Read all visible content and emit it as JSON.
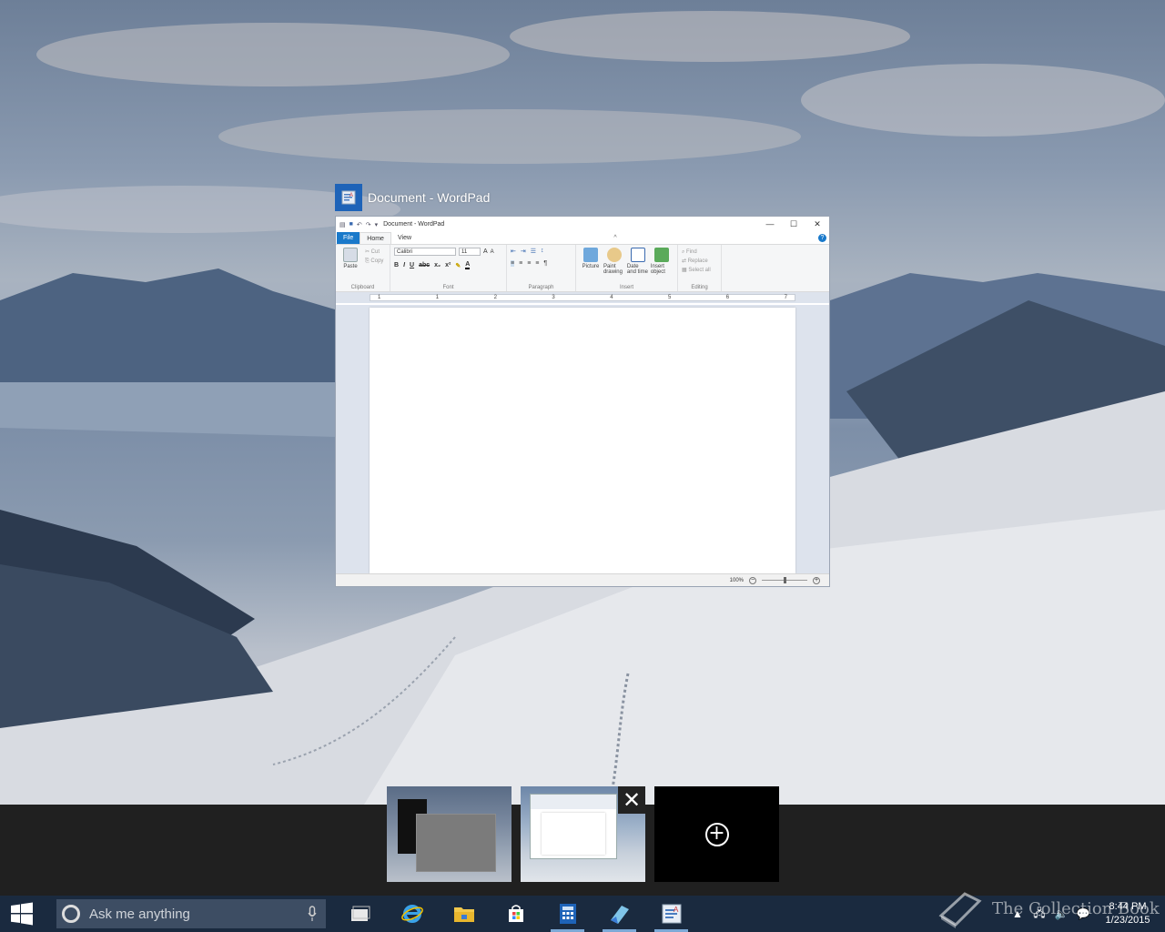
{
  "window_preview": {
    "caption": "Document - WordPad",
    "wordpad": {
      "title": "Document - WordPad",
      "tabs": [
        "File",
        "Home",
        "View"
      ],
      "ribbon": {
        "clipboard": {
          "label": "Clipboard",
          "paste": "Paste",
          "cut": "Cut",
          "copy": "Copy"
        },
        "font": {
          "label": "Font",
          "family": "Calibri",
          "size": "11"
        },
        "paragraph": {
          "label": "Paragraph"
        },
        "insert": {
          "label": "Insert",
          "picture": "Picture",
          "paint": "Paint drawing",
          "datetime": "Date and time",
          "object": "Insert object"
        },
        "editing": {
          "label": "Editing",
          "find": "Find",
          "replace": "Replace",
          "select_all": "Select all"
        }
      },
      "ruler_marks": [
        "1",
        "1",
        "2",
        "3",
        "4",
        "5",
        "6",
        "7"
      ],
      "zoom": "100%"
    }
  },
  "taskbar": {
    "search_placeholder": "Ask me anything",
    "clock_time": "8:44 PM",
    "clock_date": "1/23/2015"
  },
  "watermark": "The Collection Book"
}
